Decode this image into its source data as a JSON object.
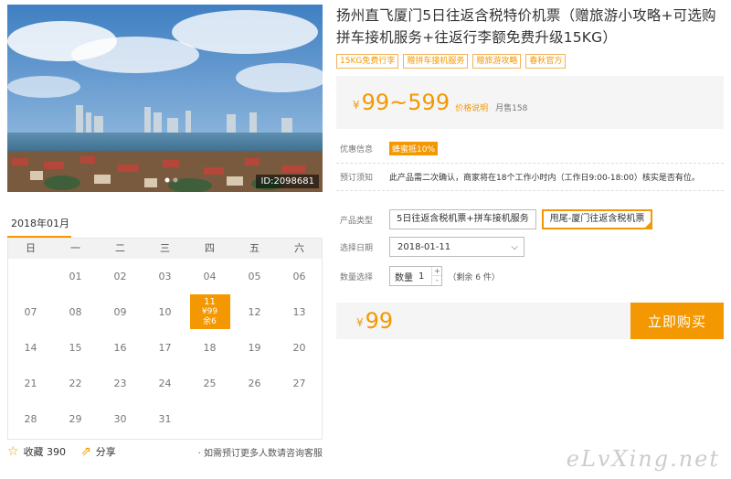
{
  "product": {
    "title": "扬州直飞厦门5日往返含税特价机票（赠旅游小攻略+可选购拼车接机服务+往返行李额免费升级15KG）",
    "tags": [
      "15KG免费行李",
      "赠拼车接机服务",
      "赠旅游攻略",
      "春秋官方"
    ],
    "image_id": "ID:2098681",
    "currency": "¥",
    "price_range": "99~599",
    "price_note": "价格说明",
    "sold": "月售158"
  },
  "info": {
    "discount_label": "优惠信息",
    "discount_badge": "蜂蜜抵10%",
    "notice_label": "预订须知",
    "notice_text": "此产品需二次确认，商家将在18个工作小时内（工作日9:00-18:00）核实是否有位。"
  },
  "options": {
    "type_label": "产品类型",
    "types": [
      "5日往返含税机票+拼车接机服务",
      "甩尾-厦门往返含税机票"
    ],
    "date_label": "选择日期",
    "date_value": "2018-01-11",
    "qty_label": "数量选择",
    "qty_text": "数量",
    "qty_value": "1",
    "plus": "+",
    "minus": "-",
    "remain": "（剩余 6 件）"
  },
  "total": {
    "currency": "¥",
    "price": "99",
    "buy_label": "立即购买"
  },
  "calendar": {
    "month": "2018年01月",
    "weekdays": [
      "日",
      "一",
      "二",
      "三",
      "四",
      "五",
      "六"
    ],
    "rows": [
      [
        "",
        "01",
        "02",
        "03",
        "04",
        "05",
        "06"
      ],
      [
        "07",
        "08",
        "09",
        "10",
        "11",
        "12",
        "13"
      ],
      [
        "14",
        "15",
        "16",
        "17",
        "18",
        "19",
        "20"
      ],
      [
        "21",
        "22",
        "23",
        "24",
        "25",
        "26",
        "27"
      ],
      [
        "28",
        "29",
        "30",
        "31",
        "",
        "",
        ""
      ]
    ],
    "active": {
      "day": "11",
      "price": "¥99",
      "stock": "余6"
    }
  },
  "footer": {
    "fav_label": "收藏 390",
    "share_label": "分享",
    "note": "· 如需预订更多人数请咨询客服"
  },
  "watermark": "eLvXing.net",
  "colors": {
    "accent": "#f39800"
  }
}
